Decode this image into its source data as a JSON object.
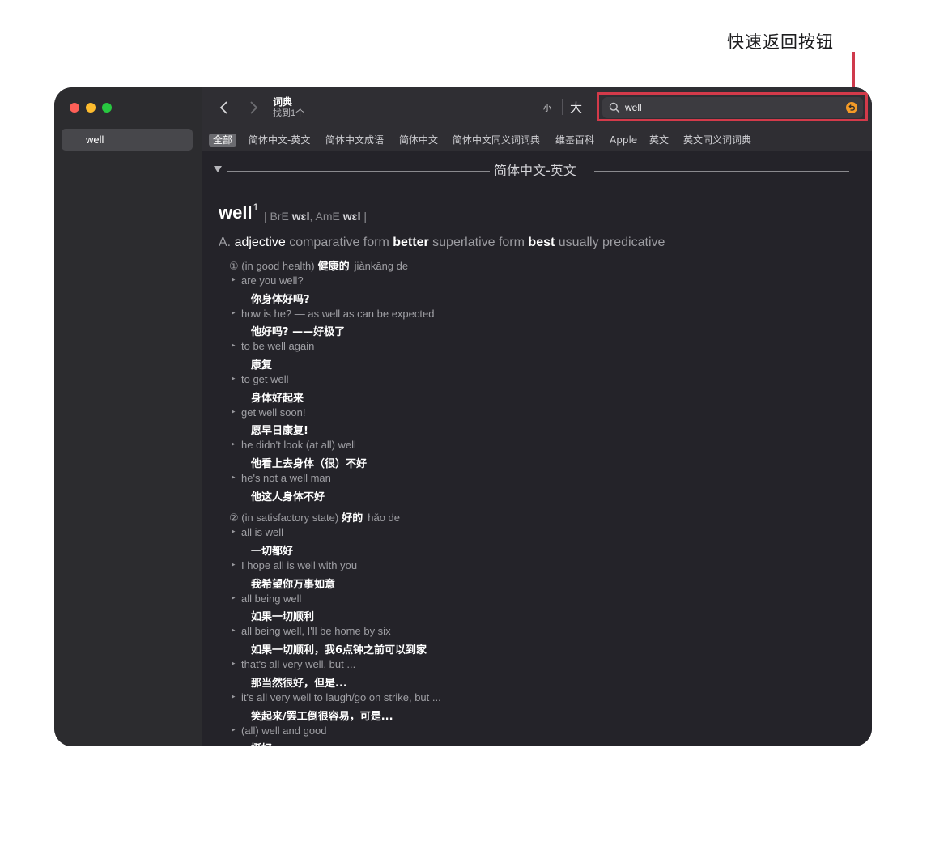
{
  "annotation": {
    "label": "快速返回按钮"
  },
  "sidebar": {
    "items": [
      {
        "label": "well"
      }
    ]
  },
  "toolbar": {
    "title": "词典",
    "subtitle": "找到1个",
    "font_small": "小",
    "font_large": "大",
    "search": {
      "value": "well",
      "placeholder": ""
    }
  },
  "tabs": [
    {
      "label": "全部",
      "active": true
    },
    {
      "label": "简体中文-英文"
    },
    {
      "label": "简体中文成语"
    },
    {
      "label": "简体中文"
    },
    {
      "label": "简体中文同义词词典"
    },
    {
      "label": "维基百科"
    },
    {
      "label": "Apple"
    },
    {
      "label": "英文"
    },
    {
      "label": "英文同义词词典"
    }
  ],
  "entry": {
    "section_title": "简体中文-英文",
    "headword": "well",
    "superscript": "1",
    "pron": {
      "sep1": "| BrE ",
      "bre": "wɛl",
      "sep2": ",  AmE ",
      "ame": "wɛl",
      "sep3": " |"
    },
    "pos": {
      "letter": "A.",
      "word": "adjective",
      "comp_label": "comparative form",
      "comp": "better",
      "sup_label": "superlative form",
      "sup": "best",
      "note": "usually predicative"
    },
    "senses": [
      {
        "num": "①",
        "gloss": "(in good health)",
        "cn": "健康的",
        "pinyin": "jiànkāng de",
        "examples": [
          {
            "en": "are you well?",
            "zh": "你身体好吗?"
          },
          {
            "en": "how is he? — as well as can be expected",
            "zh": "他好吗? ——好极了"
          },
          {
            "en": "to be well again",
            "zh": "康复"
          },
          {
            "en": "to get well",
            "zh": "身体好起来"
          },
          {
            "en": "get well soon!",
            "zh": "愿早日康复!"
          },
          {
            "en": "he didn't look (at all) well",
            "zh": "他看上去身体（很）不好"
          },
          {
            "en": "he's not a well man",
            "zh": "他这人身体不好"
          }
        ]
      },
      {
        "num": "②",
        "gloss": "(in satisfactory state)",
        "cn": "好的",
        "pinyin": "hǎo de",
        "examples": [
          {
            "en": "all is well",
            "zh": "一切都好"
          },
          {
            "en": "I hope all is well with you",
            "zh": "我希望你万事如意"
          },
          {
            "en": "all being well",
            "zh": "如果一切顺利"
          },
          {
            "en": "all being well, I'll be home by six",
            "zh": "如果一切顺利，我6点钟之前可以到家"
          },
          {
            "en": "that's all very well, but ...",
            "zh": "那当然很好，但是..."
          },
          {
            "en": "it's all very well to laugh/go on strike, but ...",
            "zh": "笑起来/罢工倒很容易，可是..."
          },
          {
            "en": "(all) well and good",
            "zh": "挺好"
          }
        ]
      }
    ]
  },
  "colors": {
    "accent_orange": "#f39a27",
    "highlight_red": "#d33a4a"
  },
  "icons": [
    "close-dot",
    "minimize-dot",
    "zoom-dot",
    "chevron-left-icon",
    "chevron-right-icon",
    "search-icon",
    "back-arrow-icon",
    "disclosure-triangle-icon"
  ]
}
